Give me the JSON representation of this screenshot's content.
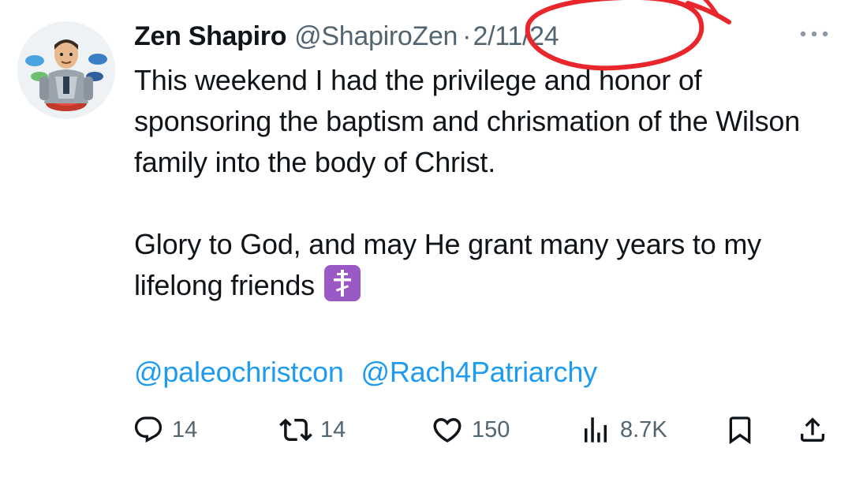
{
  "tweet": {
    "author": {
      "display_name": "Zen Shapiro",
      "handle": "@ShapiroZen",
      "avatar_icon": "bitmoji-avatar"
    },
    "separator": "·",
    "date": "2/11/24",
    "more_icon": "more-dots-icon",
    "body": {
      "paragraph_1": "This weekend I had the privilege and honor of sponsoring the baptism and chrismation of the Wilson family into the body of Christ.",
      "paragraph_2": "Glory to God, and may He grant many years to my lifelong friends",
      "emoji": "orthodox-cross-emoji"
    },
    "mentions": [
      "@paleochristcon",
      "@Rach4Patriarchy"
    ],
    "metrics": {
      "replies": "14",
      "reposts": "14",
      "likes": "150",
      "views": "8.7K"
    },
    "colors": {
      "text": "#0f1419",
      "secondary": "#536471",
      "link": "#1d9bf0",
      "annotation": "#e8262b",
      "emoji_bg": "#9b59c6"
    }
  }
}
